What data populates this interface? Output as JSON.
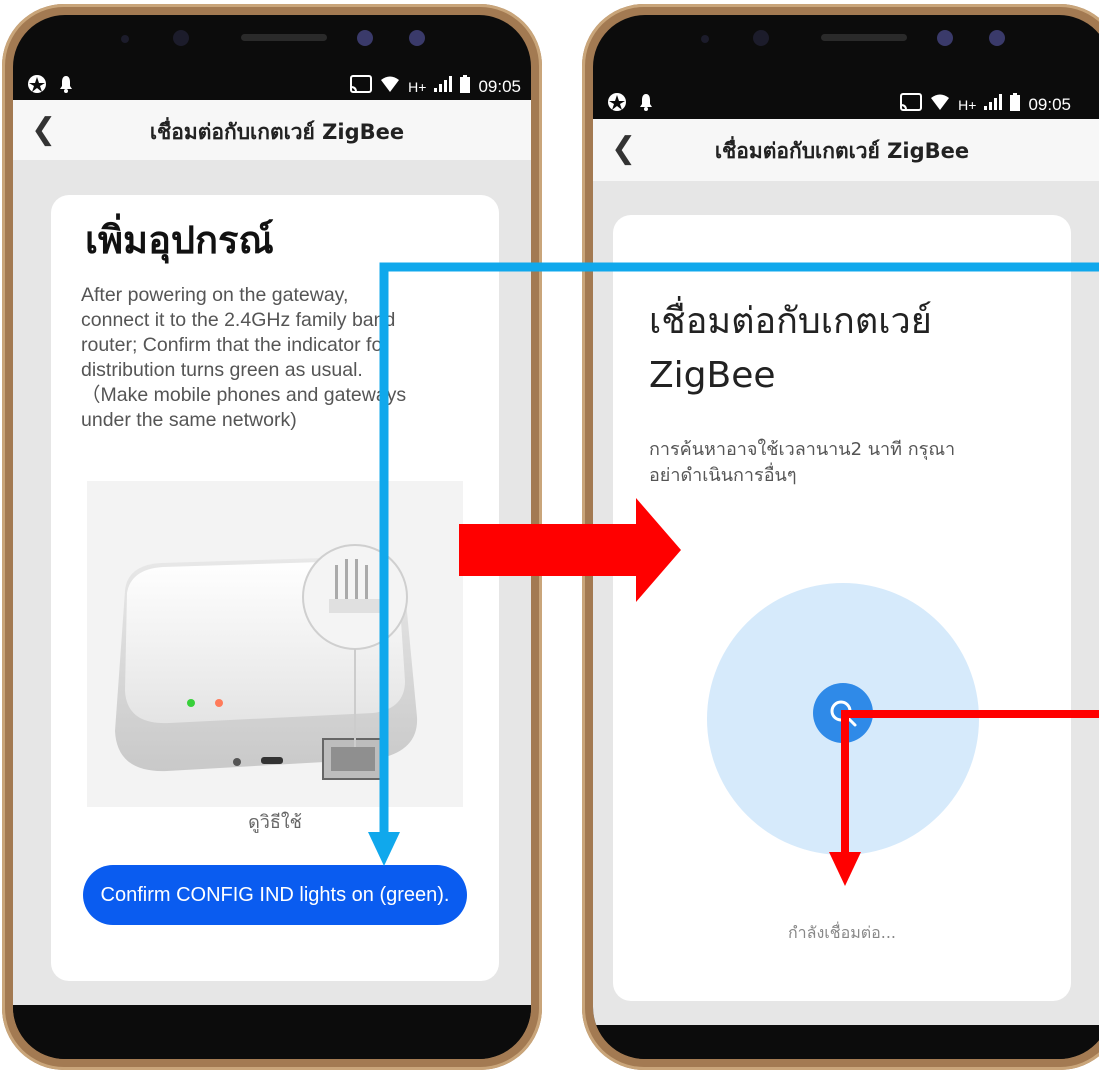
{
  "status": {
    "time": "09:05",
    "network": "H+"
  },
  "left_screen": {
    "nav_title": "เชื่อมต่อกับเกตเวย์ ZigBee",
    "heading": "เพิ่มอุปกรณ์",
    "instructions_lines": [
      "After powering on the gateway,",
      "connect it to the 2.4GHz family band",
      "router; Confirm that the indicator for",
      "distribution turns green as usual.",
      "（Make mobile phones and gateways",
      "under the same network)"
    ],
    "help_link": "ดูวิธีใช้",
    "confirm_button": "Confirm CONFIG IND lights on (green)."
  },
  "right_screen": {
    "nav_title": "เชื่อมต่อกับเกตเวย์ ZigBee",
    "heading_line1": "เชื่อมต่อกับเกตเวย์",
    "heading_line2": "ZigBee",
    "subtitle_line1": "การค้นหาอาจใช้เวลานาน2 นาที กรุณา",
    "subtitle_line2": "อย่าดำเนินการอื่นๆ",
    "connecting_text": "กำลังเชื่อมต่อ..."
  },
  "colors": {
    "accent": "#0a5cf0",
    "arrow_red": "#ff0000",
    "arrow_cyan": "#10a8ec",
    "search_circle": "#d6eafb",
    "search_btn": "#2f8ae8"
  }
}
